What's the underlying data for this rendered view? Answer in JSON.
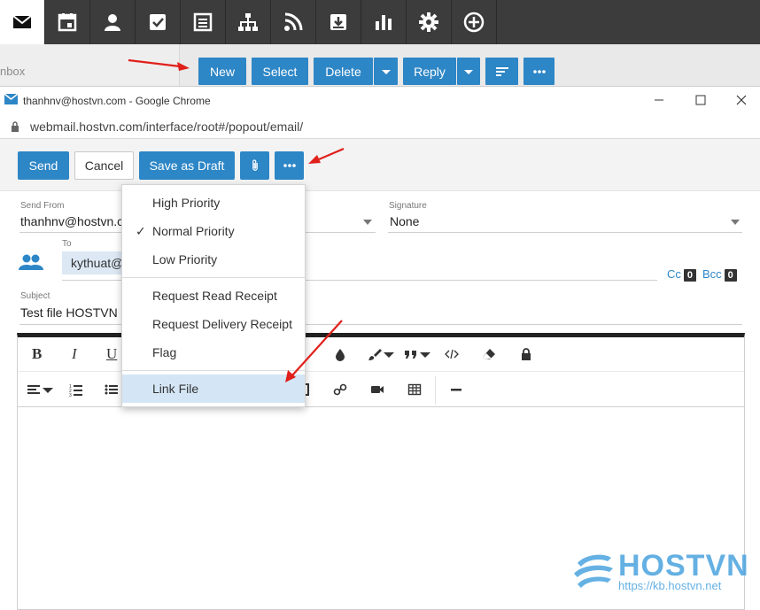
{
  "colors": {
    "accent": "#2d86c6",
    "nav_bg": "#3c3c3c",
    "menu_highlight": "#d4e6f5",
    "annotation": "#e0201b",
    "watermark": "#4aa3df"
  },
  "appnav": {
    "items": [
      {
        "icon": "mail-icon",
        "active": true
      },
      {
        "icon": "calendar-icon"
      },
      {
        "icon": "contacts-icon"
      },
      {
        "icon": "tasks-icon"
      },
      {
        "icon": "notes-icon"
      },
      {
        "icon": "sitemap-icon"
      },
      {
        "icon": "rss-icon"
      },
      {
        "icon": "archive-icon"
      },
      {
        "icon": "reports-icon"
      },
      {
        "icon": "settings-icon"
      },
      {
        "icon": "add-circle-icon"
      }
    ]
  },
  "mail_toolbar": {
    "folder_label": "nbox",
    "new_label": "New",
    "select_label": "Select",
    "delete_label": "Delete",
    "reply_label": "Reply"
  },
  "chrome": {
    "title": "thanhnv@hostvn.com - Google Chrome",
    "url": "webmail.hostvn.com/interface/root#/popout/email/"
  },
  "compose": {
    "send_label": "Send",
    "cancel_label": "Cancel",
    "save_draft_label": "Save as Draft",
    "send_from_label": "Send From",
    "send_from_value": "thanhnv@hostvn.c",
    "signature_label": "Signature",
    "signature_value": "None",
    "to_label": "To",
    "to_chip": "kythuat@",
    "cc_label": "Cc",
    "cc_count": "0",
    "bcc_label": "Bcc",
    "bcc_count": "0",
    "subject_label": "Subject",
    "subject_value": "Test file HOSTVN"
  },
  "editor": {
    "bold_label": "B",
    "italic_label": "I",
    "underline_label": "U"
  },
  "more_menu": {
    "items": [
      {
        "label": "High Priority",
        "checked": false
      },
      {
        "label": "Normal Priority",
        "checked": true
      },
      {
        "label": "Low Priority",
        "checked": false
      },
      {
        "label": "Request Read Receipt",
        "checked": false
      },
      {
        "label": "Request Delivery Receipt",
        "checked": false
      },
      {
        "label": "Flag",
        "checked": false
      },
      {
        "label": "Link File",
        "checked": false,
        "highlighted": true
      }
    ],
    "check_glyph": "✓"
  },
  "watermark": {
    "brand": "HOSTVN",
    "url": "https://kb.hostvn.net"
  }
}
